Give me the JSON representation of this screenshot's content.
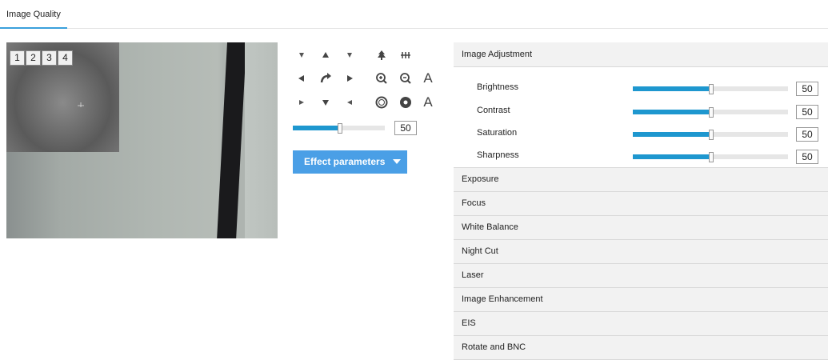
{
  "tabs": [
    {
      "label": "Image Quality"
    }
  ],
  "preview": {
    "pip_buttons": [
      "1",
      "2",
      "3",
      "4"
    ]
  },
  "ptz": {
    "buttons": [
      "arrow-up-left-icon",
      "arrow-up-icon",
      "arrow-up-right-icon",
      "tree-icon",
      "wiper-icon",
      "arrow-left-icon",
      "auto-rotate-icon",
      "arrow-right-icon",
      "zoom-in-icon",
      "zoom-out-icon",
      "auto-zoom-label",
      "arrow-down-left-icon",
      "arrow-down-icon",
      "arrow-down-right-icon",
      "iris-open-icon",
      "iris-close-icon",
      "auto-iris-label"
    ],
    "auto_label": "A",
    "speed": {
      "value": "50",
      "level": 0.5
    }
  },
  "effect_button": {
    "label": "Effect parameters"
  },
  "panel": {
    "image_adjustment": {
      "title": "Image Adjustment",
      "rows": [
        {
          "label": "Brightness",
          "value": "50",
          "level": 0.5
        },
        {
          "label": "Contrast",
          "value": "50",
          "level": 0.5
        },
        {
          "label": "Saturation",
          "value": "50",
          "level": 0.5
        },
        {
          "label": "Sharpness",
          "value": "50",
          "level": 0.5
        }
      ]
    },
    "sections": [
      "Exposure",
      "Focus",
      "White Balance",
      "Night Cut",
      "Laser",
      "Image Enhancement",
      "EIS",
      "Rotate and BNC"
    ]
  },
  "colors": {
    "accent": "#1e97cf",
    "button": "#4a9fe6"
  }
}
